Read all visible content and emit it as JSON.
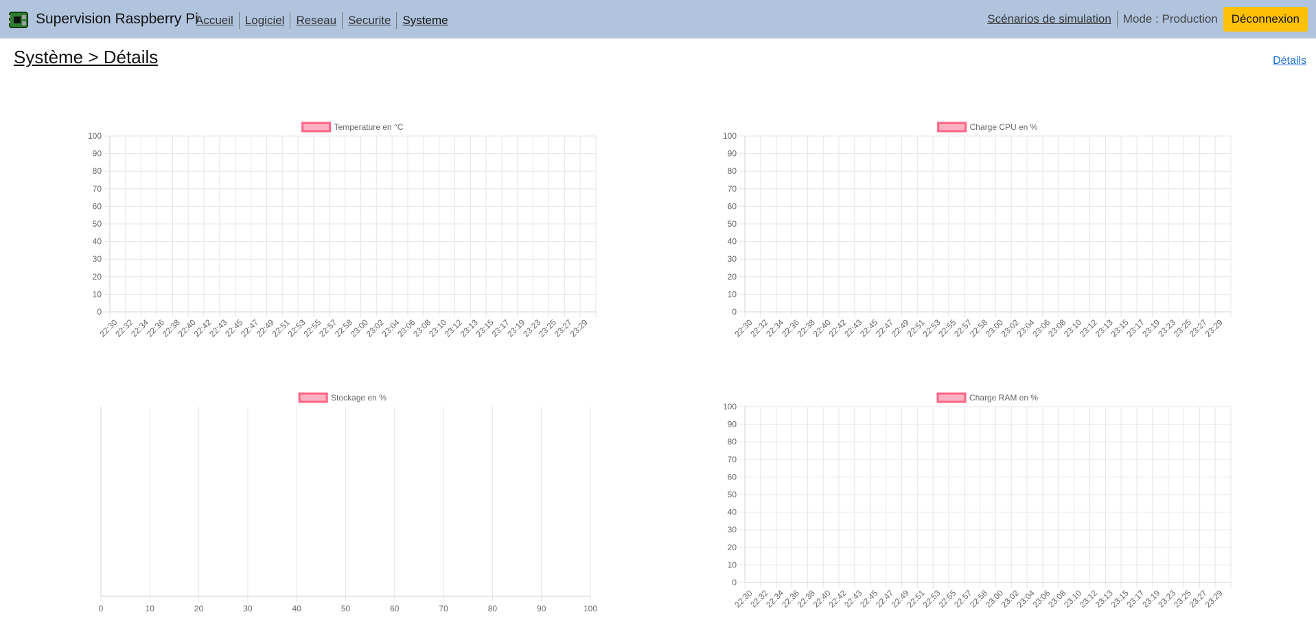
{
  "app": {
    "title": "Supervision Raspberry Pi"
  },
  "nav": {
    "items": [
      {
        "label": "Accueil"
      },
      {
        "label": "Logiciel"
      },
      {
        "label": "Reseau"
      },
      {
        "label": "Securite"
      },
      {
        "label": "Systeme"
      }
    ]
  },
  "right": {
    "scenarios": "Scénarios de simulation",
    "mode": "Mode : Production",
    "logout": "Déconnexion"
  },
  "page": {
    "title": "Système > Détails",
    "details_link": "Détails"
  },
  "colors": {
    "header_bg": "#b0c4de",
    "logout_bg": "#ffc107",
    "series_border": "#ff6384",
    "series_fill": "#ffb1c1",
    "link": "#1a6fd4"
  },
  "chart_data": [
    {
      "type": "line",
      "legend": "Temperature en °C",
      "x": [
        "22:30",
        "22:32",
        "22:34",
        "22:36",
        "22:38",
        "22:40",
        "22:42",
        "22:43",
        "22:45",
        "22:47",
        "22:49",
        "22:51",
        "22:53",
        "22:55",
        "22:57",
        "22:58",
        "23:00",
        "23:02",
        "23:04",
        "23:06",
        "23:08",
        "23:10",
        "23:12",
        "23:13",
        "23:15",
        "23:17",
        "23:19",
        "23:23",
        "23:25",
        "23:27",
        "23:29"
      ],
      "series": [
        {
          "name": "Temperature en °C",
          "values": []
        }
      ],
      "ylim": [
        0,
        100
      ],
      "yticks": [
        "0",
        "10",
        "20",
        "30",
        "40",
        "50",
        "60",
        "70",
        "80",
        "90",
        "100"
      ],
      "grid": true,
      "legend_position": "top"
    },
    {
      "type": "line",
      "legend": "Charge CPU en %",
      "x": [
        "22:30",
        "22:32",
        "22:34",
        "22:36",
        "22:38",
        "22:40",
        "22:42",
        "22:43",
        "22:45",
        "22:47",
        "22:49",
        "22:51",
        "22:53",
        "22:55",
        "22:57",
        "22:58",
        "23:00",
        "23:02",
        "23:04",
        "23:06",
        "23:08",
        "23:10",
        "23:12",
        "23:13",
        "23:15",
        "23:17",
        "23:19",
        "23:23",
        "23:25",
        "23:27",
        "23:29"
      ],
      "series": [
        {
          "name": "Charge CPU en %",
          "values": []
        }
      ],
      "ylim": [
        0,
        100
      ],
      "yticks": [
        "0",
        "10",
        "20",
        "30",
        "40",
        "50",
        "60",
        "70",
        "80",
        "90",
        "100"
      ],
      "grid": true,
      "legend_position": "top"
    },
    {
      "type": "bar",
      "legend": "Stockage en %",
      "orientation": "horizontal",
      "series": [
        {
          "name": "Stockage en %",
          "values": []
        }
      ],
      "xlim": [
        0,
        100
      ],
      "xticks": [
        "0",
        "10",
        "20",
        "30",
        "40",
        "50",
        "60",
        "70",
        "80",
        "90",
        "100"
      ],
      "grid": true,
      "legend_position": "top"
    },
    {
      "type": "line",
      "legend": "Charge RAM en %",
      "x": [
        "22:30",
        "22:32",
        "22:34",
        "22:36",
        "22:38",
        "22:40",
        "22:42",
        "22:43",
        "22:45",
        "22:47",
        "22:49",
        "22:51",
        "22:53",
        "22:55",
        "22:57",
        "22:58",
        "23:00",
        "23:02",
        "23:04",
        "23:06",
        "23:08",
        "23:10",
        "23:12",
        "23:13",
        "23:15",
        "23:17",
        "23:19",
        "23:23",
        "23:25",
        "23:27",
        "23:29"
      ],
      "series": [
        {
          "name": "Charge RAM en %",
          "values": []
        }
      ],
      "ylim": [
        0,
        100
      ],
      "yticks": [
        "0",
        "10",
        "20",
        "30",
        "40",
        "50",
        "60",
        "70",
        "80",
        "90",
        "100"
      ],
      "grid": true,
      "legend_position": "top"
    }
  ]
}
